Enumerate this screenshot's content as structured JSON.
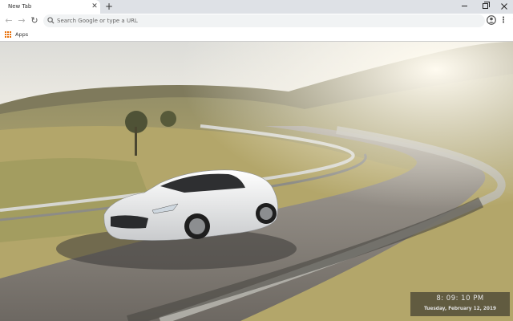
{
  "tab": {
    "title": "New Tab",
    "close_symbol": "✕"
  },
  "new_tab_symbol": "+",
  "toolbar": {
    "back_symbol": "←",
    "forward_symbol": "→",
    "reload_symbol": "↻",
    "omnibox_placeholder": "Search Google or type a URL",
    "menu_symbol": "⋮",
    "star_symbol": "☆"
  },
  "bookmarks": {
    "apps_label": "Apps"
  },
  "clock": {
    "time": "8: 09: 10 PM",
    "date": "Tuesday, February 12, 2019"
  },
  "colors": {
    "tabstrip": "#dee1e6",
    "omnibox": "#f1f3f4",
    "apps_icon": "#e8710a"
  },
  "icons": [
    "close-icon",
    "plus-icon",
    "back-arrow-icon",
    "forward-arrow-icon",
    "reload-icon",
    "search-icon",
    "star-icon",
    "profile-icon",
    "menu-dots-icon",
    "apps-grid-icon"
  ]
}
